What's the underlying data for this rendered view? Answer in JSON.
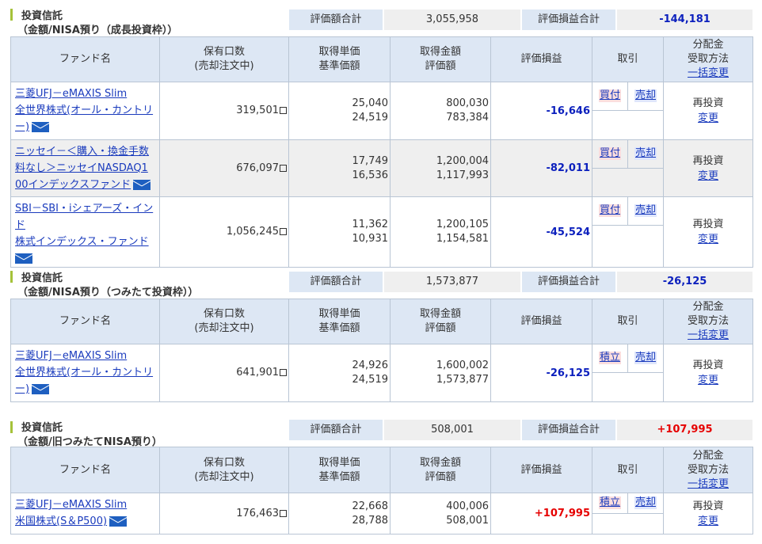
{
  "colors": {
    "header_bg": "#dde7f4",
    "value_bg": "#efefef",
    "negative": "#0b1fbd",
    "positive": "#e60000",
    "accent_bar": "#a5c23a"
  },
  "columns": {
    "fund": "ファンド名",
    "holdings_1": "保有口数",
    "holdings_2": "(売却注文中)",
    "price_1": "取得単価",
    "price_2": "基準価額",
    "amount_1": "取得金額",
    "amount_2": "評価額",
    "pl": "評価損益",
    "trade": "取引",
    "dist_1": "分配金",
    "dist_2": "受取方法",
    "dist_3": "一括変更"
  },
  "labels": {
    "total_value": "評価額合計",
    "total_pl": "評価損益合計",
    "reinvest": "再投資",
    "change": "変更",
    "sell": "売却"
  },
  "sections": [
    {
      "title": "投資信託",
      "subtitle": "（金額/NISA預り（成長投資枠））",
      "total_value": "3,055,958",
      "total_pl": "-144,181",
      "rows": [
        {
          "name_lines": [
            "三菱UFJ－eMAXIS Slim",
            "全世界株式(オール・カントリ",
            "ー)"
          ],
          "holdings": "319,501",
          "price_acq": "25,040",
          "price_base": "24,519",
          "amount_acq": "800,030",
          "amount_eval": "783,384",
          "pl": "-16,646",
          "buy": "買付"
        },
        {
          "name_lines": [
            "ニッセイ－＜購入・換金手数",
            "料なし＞ニッセイNASDAQ1",
            "00インデックスファンド"
          ],
          "holdings": "676,097",
          "price_acq": "17,749",
          "price_base": "16,536",
          "amount_acq": "1,200,004",
          "amount_eval": "1,117,993",
          "pl": "-82,011",
          "buy": "買付"
        },
        {
          "name_lines": [
            "SBI－SBI・iシェアーズ・インド",
            "株式インデックス・ファンド",
            ""
          ],
          "holdings": "1,056,245",
          "price_acq": "11,362",
          "price_base": "10,931",
          "amount_acq": "1,200,105",
          "amount_eval": "1,154,581",
          "pl": "-45,524",
          "buy": "買付"
        }
      ]
    },
    {
      "title": "投資信託",
      "subtitle": "（金額/NISA預り（つみたて投資枠））",
      "total_value": "1,573,877",
      "total_pl": "-26,125",
      "rows": [
        {
          "name_lines": [
            "三菱UFJ－eMAXIS Slim",
            "全世界株式(オール・カントリ",
            "ー)"
          ],
          "holdings": "641,901",
          "price_acq": "24,926",
          "price_base": "24,519",
          "amount_acq": "1,600,002",
          "amount_eval": "1,573,877",
          "pl": "-26,125",
          "buy": "積立"
        }
      ]
    },
    {
      "title": "投資信託",
      "subtitle": "（金額/旧つみたてNISA預り）",
      "total_value": "508,001",
      "total_pl": "+107,995",
      "rows": [
        {
          "name_lines": [
            "三菱UFJ－eMAXIS Slim",
            "米国株式(S＆P500)",
            ""
          ],
          "holdings": "176,463",
          "price_acq": "22,668",
          "price_base": "28,788",
          "amount_acq": "400,006",
          "amount_eval": "508,001",
          "pl": "+107,995",
          "buy": "積立"
        }
      ]
    }
  ]
}
